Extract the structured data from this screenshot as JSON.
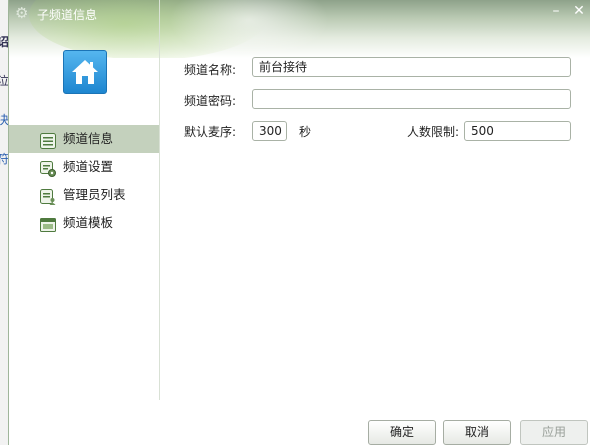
{
  "window": {
    "title": "子频道信息",
    "colors": {
      "header_top": "#8ea28a",
      "active_nav": "#c4d1bd",
      "home_tile": "#1e86d0"
    }
  },
  "background_app": {
    "fragments": [
      "诏",
      "泣",
      "决",
      "符"
    ]
  },
  "sidebar": {
    "items": [
      {
        "label": "频道信息",
        "icon": "info-list-icon",
        "active": true
      },
      {
        "label": "频道设置",
        "icon": "settings-gear-icon",
        "active": false
      },
      {
        "label": "管理员列表",
        "icon": "admin-list-icon",
        "active": false
      },
      {
        "label": "频道模板",
        "icon": "template-icon",
        "active": false
      }
    ]
  },
  "form": {
    "name_label": "频道名称:",
    "name_value": "前台接待",
    "password_label": "频道密码:",
    "password_value": "",
    "mic_order_label": "默认麦序:",
    "mic_order_value": "300",
    "mic_order_unit": "秒",
    "people_limit_label": "人数限制:",
    "people_limit_value": "500"
  },
  "footer": {
    "ok_label": "确定",
    "cancel_label": "取消",
    "apply_label": "应用"
  }
}
